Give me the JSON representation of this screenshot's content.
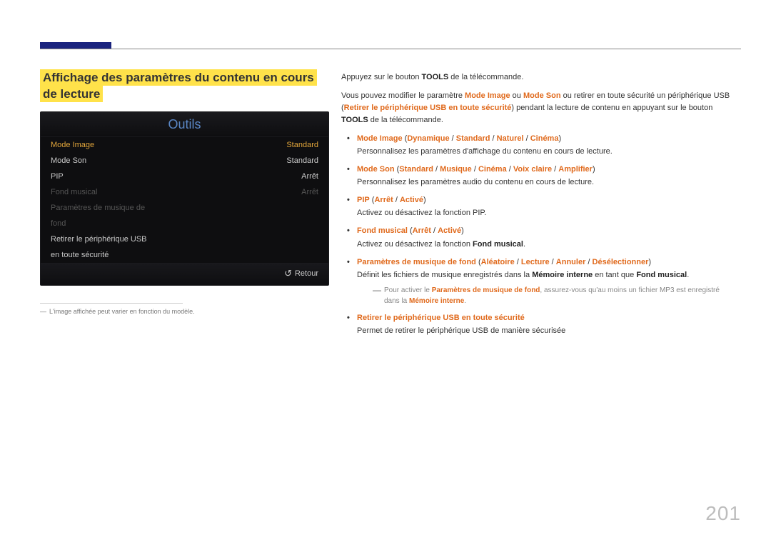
{
  "page_number": "201",
  "section_title": "Affichage des paramètres du contenu en cours de lecture",
  "osd": {
    "title": "Outils",
    "rows": [
      {
        "label": "Mode Image",
        "value": "Standard",
        "selected": true
      },
      {
        "label": "Mode Son",
        "value": "Standard"
      },
      {
        "label": "PIP",
        "value": "Arrêt"
      },
      {
        "label": "Fond musical",
        "value": "Arrêt",
        "dim": true
      },
      {
        "label": "Paramètres de musique de",
        "value": "",
        "dim": true
      },
      {
        "label": "fond",
        "value": "",
        "dim": true
      },
      {
        "label": "Retirer le périphérique USB",
        "value": ""
      },
      {
        "label": "en toute sécurité",
        "value": ""
      }
    ],
    "footer": "Retour"
  },
  "footnote": "L'image affichée peut varier en fonction du modèle.",
  "intro1_pre": "Appuyez sur le bouton ",
  "intro1_bold": "TOOLS",
  "intro1_post": " de la télécommande.",
  "intro2": {
    "a": "Vous pouvez modifier le paramètre ",
    "mode_image": "Mode Image",
    "b": " ou ",
    "mode_son": "Mode Son",
    "c": " ou retirer en toute sécurité un périphérique USB (",
    "retirer": "Retirer le périphérique USB en toute sécurité",
    "d": ") pendant la lecture de contenu en appuyant sur le bouton ",
    "tools": "TOOLS",
    "e": " de la télécommande."
  },
  "items": {
    "mode_image": {
      "name": "Mode Image",
      "opts": [
        "Dynamique",
        "Standard",
        "Naturel",
        "Cinéma"
      ],
      "desc": "Personnalisez les paramètres d'affichage du contenu en cours de lecture."
    },
    "mode_son": {
      "name": "Mode Son",
      "opts": [
        "Standard",
        "Musique",
        "Cinéma",
        "Voix claire",
        "Amplifier"
      ],
      "desc": "Personnalisez les paramètres audio du contenu en cours de lecture."
    },
    "pip": {
      "name": "PIP",
      "opts": [
        "Arrêt",
        "Activé"
      ],
      "desc": "Activez ou désactivez la fonction PIP."
    },
    "fond_musical": {
      "name": "Fond musical",
      "opts": [
        "Arrêt",
        "Activé"
      ],
      "desc_a": "Activez ou désactivez la fonction ",
      "desc_b": "Fond musical",
      "desc_c": "."
    },
    "params_musique": {
      "name": "Paramètres de musique de fond",
      "opts": [
        "Aléatoire",
        "Lecture",
        "Annuler",
        "Désélectionner"
      ],
      "desc_a": "Définit les fichiers de musique enregistrés dans la ",
      "desc_b": "Mémoire interne",
      "desc_c": " en tant que ",
      "desc_d": "Fond musical",
      "desc_e": ".",
      "note_a": "Pour activer le ",
      "note_b": "Paramètres de musique de fond",
      "note_c": ", assurez-vous qu'au moins un fichier MP3 est enregistré dans la ",
      "note_d": "Mémoire interne",
      "note_e": "."
    },
    "retirer_usb": {
      "name": "Retirer le périphérique USB en toute sécurité",
      "desc": "Permet de retirer le périphérique USB de manière sécurisée"
    }
  },
  "sep": " / "
}
